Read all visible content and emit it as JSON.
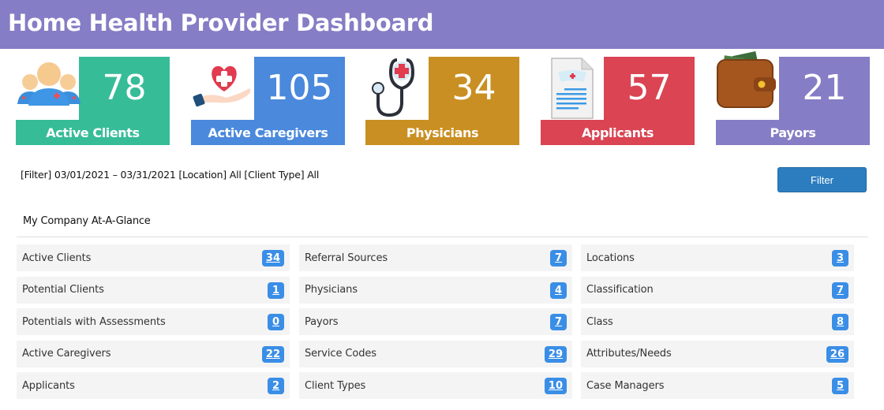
{
  "header": {
    "title": "Home Health Provider Dashboard"
  },
  "colors": {
    "header": "#857dc5",
    "active_clients": "#37bc98",
    "active_caregivers": "#4a89dc",
    "physicians": "#c98f22",
    "applicants": "#da4453",
    "payors": "#857dc5",
    "badge": "#3a8ee6",
    "filter_button": "#2b7dbf"
  },
  "cards": [
    {
      "value": "78",
      "label": "Active Clients",
      "icon": "staff-group-icon"
    },
    {
      "value": "105",
      "label": "Active Caregivers",
      "icon": "hand-heart-icon"
    },
    {
      "value": "34",
      "label": "Physicians",
      "icon": "stethoscope-icon"
    },
    {
      "value": "57",
      "label": "Applicants",
      "icon": "document-icon"
    },
    {
      "value": "21",
      "label": "Payors",
      "icon": "wallet-icon"
    }
  ],
  "filter": {
    "summary": "[Filter] 03/01/2021 – 03/31/2021 [Location] All [Client Type] All",
    "button_label": "Filter"
  },
  "glance": {
    "title": "My Company At-A-Glance",
    "columns": [
      [
        {
          "label": "Active Clients",
          "count": "34"
        },
        {
          "label": "Potential Clients",
          "count": "1"
        },
        {
          "label": "Potentials with Assessments",
          "count": "0"
        },
        {
          "label": "Active Caregivers",
          "count": "22"
        },
        {
          "label": "Applicants",
          "count": "2"
        }
      ],
      [
        {
          "label": "Referral Sources",
          "count": "7"
        },
        {
          "label": "Physicians",
          "count": "4"
        },
        {
          "label": "Payors",
          "count": "7"
        },
        {
          "label": "Service Codes",
          "count": "29"
        },
        {
          "label": "Client Types",
          "count": "10"
        }
      ],
      [
        {
          "label": "Locations",
          "count": "3"
        },
        {
          "label": "Classification",
          "count": "7"
        },
        {
          "label": "Class",
          "count": "8"
        },
        {
          "label": "Attributes/Needs",
          "count": "26"
        },
        {
          "label": "Case Managers",
          "count": "5"
        }
      ]
    ]
  }
}
